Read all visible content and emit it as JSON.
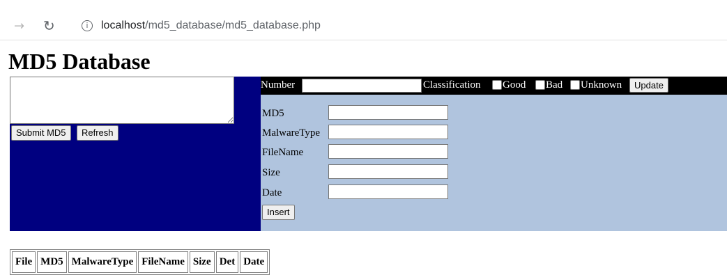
{
  "browser": {
    "url_host": "localhost",
    "url_path": "/md5_database/md5_database.php"
  },
  "page": {
    "title": "MD5 Database"
  },
  "left_panel": {
    "textarea_value": "",
    "submit_label": "Submit MD5",
    "refresh_label": "Refresh"
  },
  "top_bar": {
    "number_label": "Number",
    "number_value": "",
    "classification_label": "Classification",
    "options": [
      "Good",
      "Bad",
      "Unknown"
    ],
    "update_label": "Update"
  },
  "insert_form": {
    "fields": [
      {
        "label": "MD5",
        "value": ""
      },
      {
        "label": "MalwareType",
        "value": ""
      },
      {
        "label": "FileName",
        "value": ""
      },
      {
        "label": "Size",
        "value": ""
      },
      {
        "label": "Date",
        "value": ""
      }
    ],
    "insert_label": "Insert"
  },
  "table": {
    "headers": [
      "File",
      "MD5",
      "MalwareType",
      "FileName",
      "Size",
      "Det",
      "Date"
    ]
  },
  "colors": {
    "left_panel_bg": "#000080",
    "top_bar_bg": "#000000",
    "form_bg": "#b0c4de"
  }
}
